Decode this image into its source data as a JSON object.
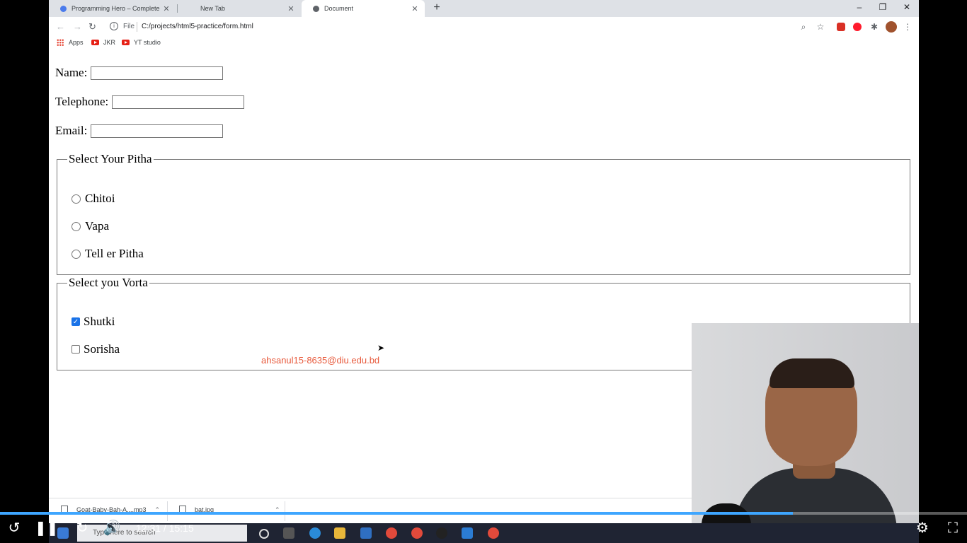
{
  "browser": {
    "tabs": [
      {
        "title": "Programming Hero – Complete",
        "active": false
      },
      {
        "title": "New Tab",
        "active": false
      },
      {
        "title": "Document",
        "active": true
      }
    ],
    "new_tab_label": "+",
    "window_controls": {
      "minimize": "–",
      "restore": "❐",
      "close": "✕"
    },
    "nav": {
      "back": "←",
      "forward": "→",
      "reload": "↻"
    },
    "address": {
      "scheme_label": "File",
      "url": "C:/projects/html5-practice/form.html"
    },
    "bookmarks": [
      "Apps",
      "JKR",
      "YT studio"
    ]
  },
  "form": {
    "fields": [
      {
        "label": "Name:",
        "value": ""
      },
      {
        "label": "Telephone:",
        "value": ""
      },
      {
        "label": "Email:",
        "value": ""
      }
    ],
    "pitha": {
      "legend": "Select Your Pitha",
      "options": [
        "Chitoi",
        "Vapa",
        "Tell er Pitha"
      ]
    },
    "vorta": {
      "legend": "Select you Vorta",
      "options": [
        {
          "label": "Shutki",
          "checked": true
        },
        {
          "label": "Sorisha",
          "checked": false
        }
      ]
    }
  },
  "watermark": "ahsanul15-8635@diu.edu.bd",
  "downloads": [
    {
      "name": "Goat-Baby-Bah-A....mp3"
    },
    {
      "name": "bat.jpg"
    }
  ],
  "taskbar": {
    "search_placeholder": "Type here to search"
  },
  "player": {
    "current_time": "12:31",
    "duration": "15:15",
    "time_display": "12:31 / 15:15",
    "progress": 0.82,
    "accent_color": "#3ea6ff"
  }
}
